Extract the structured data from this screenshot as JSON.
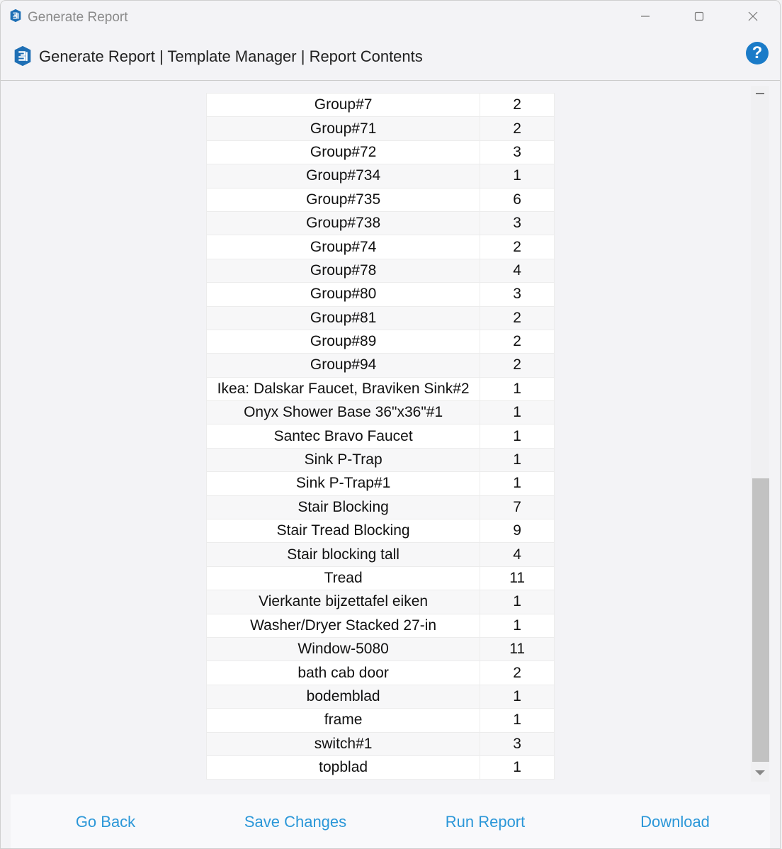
{
  "window": {
    "title": "Generate Report",
    "controls": {
      "minimize": "minimize",
      "maximize": "maximize",
      "close": "close"
    }
  },
  "header": {
    "title": "Generate Report | Template Manager | Report Contents",
    "help_label": "?"
  },
  "table": {
    "rows": [
      {
        "name": "Group#7",
        "count": "2"
      },
      {
        "name": "Group#71",
        "count": "2"
      },
      {
        "name": "Group#72",
        "count": "3"
      },
      {
        "name": "Group#734",
        "count": "1"
      },
      {
        "name": "Group#735",
        "count": "6"
      },
      {
        "name": "Group#738",
        "count": "3"
      },
      {
        "name": "Group#74",
        "count": "2"
      },
      {
        "name": "Group#78",
        "count": "4"
      },
      {
        "name": "Group#80",
        "count": "3"
      },
      {
        "name": "Group#81",
        "count": "2"
      },
      {
        "name": "Group#89",
        "count": "2"
      },
      {
        "name": "Group#94",
        "count": "2"
      },
      {
        "name": "Ikea: Dalskar Faucet, Braviken Sink#2",
        "count": "1"
      },
      {
        "name": "Onyx Shower Base 36\"x36\"#1",
        "count": "1"
      },
      {
        "name": "Santec Bravo Faucet",
        "count": "1"
      },
      {
        "name": "Sink P-Trap",
        "count": "1"
      },
      {
        "name": "Sink P-Trap#1",
        "count": "1"
      },
      {
        "name": "Stair Blocking",
        "count": "7"
      },
      {
        "name": "Stair Tread Blocking",
        "count": "9"
      },
      {
        "name": "Stair blocking tall",
        "count": "4"
      },
      {
        "name": "Tread",
        "count": "11"
      },
      {
        "name": "Vierkante bijzettafel eiken",
        "count": "1"
      },
      {
        "name": "Washer/Dryer Stacked 27-in",
        "count": "1"
      },
      {
        "name": "Window-5080",
        "count": "11"
      },
      {
        "name": "bath cab door",
        "count": "2"
      },
      {
        "name": "bodemblad",
        "count": "1"
      },
      {
        "name": "frame",
        "count": "1"
      },
      {
        "name": "switch#1",
        "count": "3"
      },
      {
        "name": "topblad",
        "count": "1"
      }
    ]
  },
  "footer": {
    "go_back": "Go Back",
    "save_changes": "Save Changes",
    "run_report": "Run Report",
    "download": "Download"
  },
  "colors": {
    "accent": "#2b97d8",
    "help": "#1a7bc8",
    "logo": "#1e6fb5"
  }
}
